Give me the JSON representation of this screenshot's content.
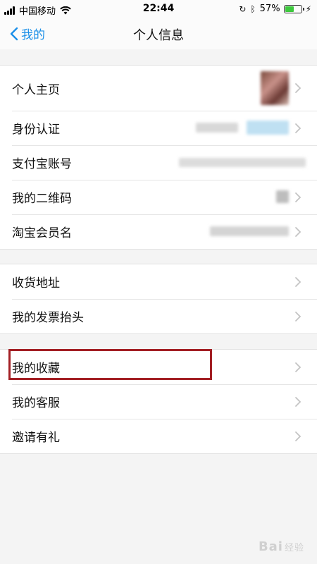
{
  "status_bar": {
    "carrier": "中国移动",
    "time": "22:44",
    "battery_percent": "57%",
    "battery_level": 0.57
  },
  "nav": {
    "back_label": "我的",
    "title": "个人信息"
  },
  "groups": [
    {
      "items": [
        {
          "label": "个人主页"
        },
        {
          "label": "身份认证"
        },
        {
          "label": "支付宝账号"
        },
        {
          "label": "我的二维码"
        },
        {
          "label": "淘宝会员名"
        }
      ]
    },
    {
      "items": [
        {
          "label": "收货地址"
        },
        {
          "label": "我的发票抬头"
        }
      ]
    },
    {
      "items": [
        {
          "label": "我的收藏"
        },
        {
          "label": "我的客服"
        },
        {
          "label": "邀请有礼"
        }
      ]
    }
  ],
  "watermark": {
    "brand": "Bai",
    "suffix": "经验"
  },
  "colors": {
    "accent": "#1a8fe8",
    "highlight": "#a31f24",
    "battery": "#3dc93d"
  }
}
